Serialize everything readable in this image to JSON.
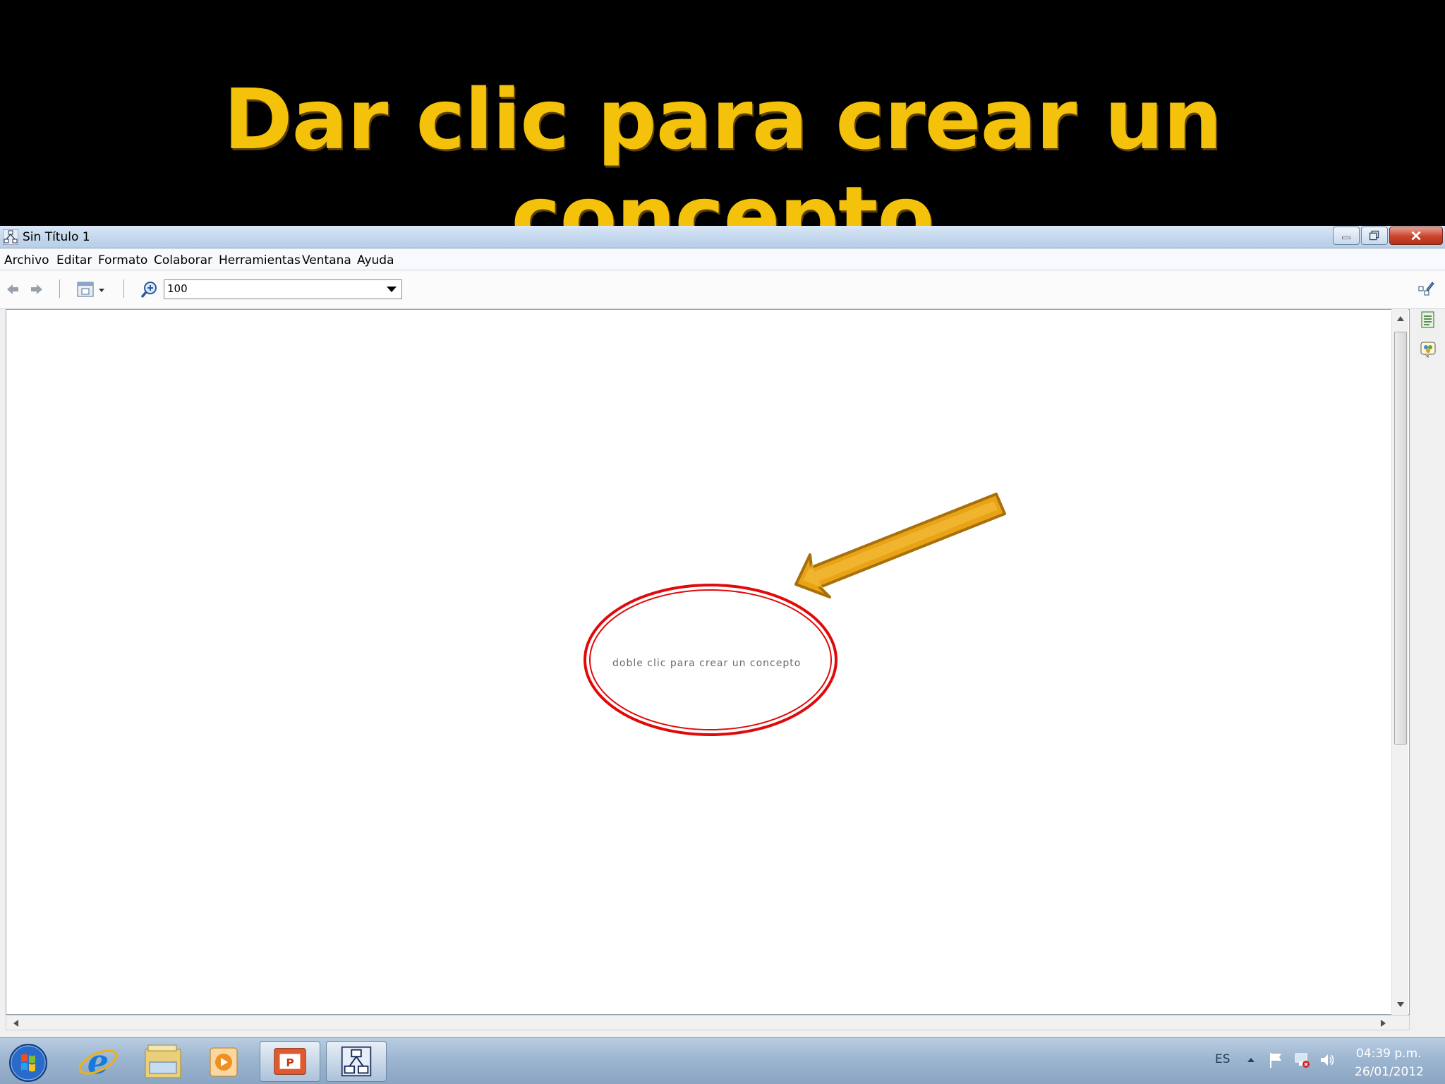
{
  "slide": {
    "title": "Dar clic para crear un concepto"
  },
  "window": {
    "title": "Sin Título 1"
  },
  "menu": [
    "Archivo",
    "Editar",
    "Formato",
    "Colaborar",
    "Herramientas",
    "Ventana",
    "Ayuda"
  ],
  "toolbar": {
    "zoom_value": "100"
  },
  "canvas": {
    "concept_hint": "doble clic para crear un concepto"
  },
  "tray": {
    "language": "ES",
    "time": "04:39 p.m.",
    "date": "26/01/2012"
  },
  "colors": {
    "title_yellow": "#f5c20b",
    "highlight_red": "#e00a0a",
    "arrow_gold": "#e8a317"
  },
  "icons": {
    "app": "cmap-icon",
    "back": "back-arrow-icon",
    "forward": "forward-arrow-icon",
    "view": "view-switch-icon",
    "zoom": "zoom-icon",
    "start": "windows-start-icon",
    "ie": "internet-explorer-icon",
    "explorer": "folder-icon",
    "media": "media-player-icon",
    "powerpoint": "powerpoint-icon",
    "cmap": "cmap-icon"
  }
}
